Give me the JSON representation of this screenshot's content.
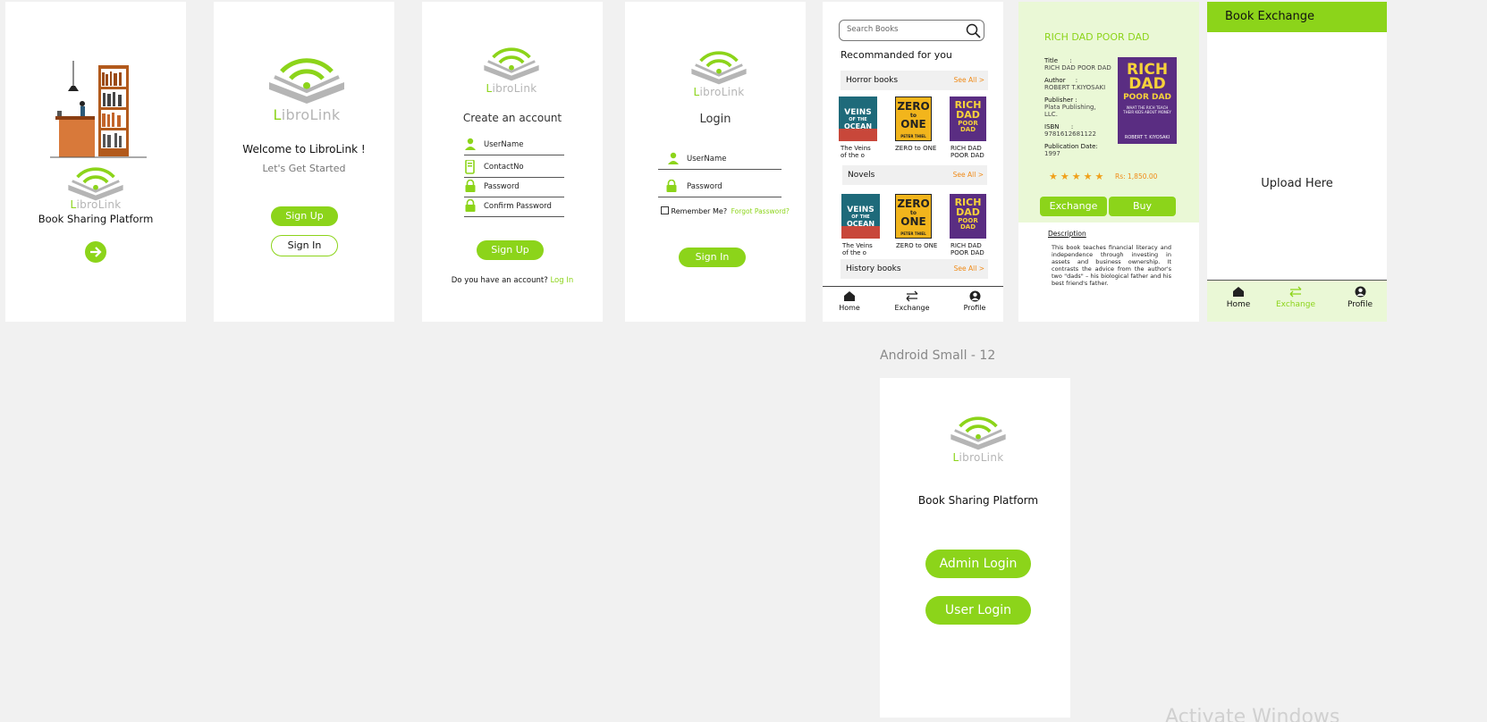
{
  "brand": {
    "logo_first": "L",
    "logo_rest": "ibroLink"
  },
  "screen1": {
    "title": "Book Sharing Platform",
    "next_icon": "arrow-right-icon"
  },
  "screen2": {
    "welcome": "Welcome to LibroLink !",
    "subtitle": "Let's Get Started",
    "signup_label": "Sign Up",
    "signin_label": "Sign In"
  },
  "screen3": {
    "title": "Create an account",
    "fields": [
      {
        "placeholder": "UserName",
        "icon": "user-icon"
      },
      {
        "placeholder": "ContactNo",
        "icon": "phone-icon"
      },
      {
        "placeholder": "Password",
        "icon": "lock-icon"
      },
      {
        "placeholder": "Confirm Password",
        "icon": "lock-icon"
      }
    ],
    "signup_label": "Sign Up",
    "login_prompt": "Do you have an account?",
    "login_link": "Log In"
  },
  "screen4": {
    "title": "Login",
    "fields": [
      {
        "placeholder": "UserName",
        "icon": "user-icon"
      },
      {
        "placeholder": "Password",
        "icon": "lock-icon"
      }
    ],
    "remember_label": "Remember Me?",
    "forgot_label": "Forgot Password?",
    "signin_label": "Sign In"
  },
  "screen5": {
    "search_placeholder": "Search Books",
    "heading": "Recommanded for you",
    "categories": [
      {
        "name": "Horror books",
        "see_all": "See All >",
        "books": [
          {
            "label": "The Veins of the o",
            "cover": "VEINS OF THE OCEAN",
            "cover_color": "#1e6a7a"
          },
          {
            "label": "ZERO to ONE",
            "cover": "ZERO to ONE",
            "cover_color": "#f2b51c"
          },
          {
            "label": "RICH DAD POOR DAD",
            "cover": "RICH DAD POOR DAD",
            "cover_color": "#5a2d82"
          }
        ]
      },
      {
        "name": "Novels",
        "see_all": "See All >",
        "books": [
          {
            "label": "The Veins of the o",
            "cover": "VEINS OF THE OCEAN",
            "cover_color": "#1e6a7a"
          },
          {
            "label": "ZERO to ONE",
            "cover": "ZERO to ONE",
            "cover_color": "#f2b51c"
          },
          {
            "label": "RICH DAD POOR DAD",
            "cover": "RICH DAD POOR DAD",
            "cover_color": "#5a2d82"
          }
        ]
      },
      {
        "name": "History books",
        "see_all": "See All >",
        "books": []
      }
    ],
    "nav": [
      {
        "label": "Home",
        "icon": "home-icon"
      },
      {
        "label": "Exchange",
        "icon": "exchange-icon"
      },
      {
        "label": "Profile",
        "icon": "profile-icon"
      }
    ]
  },
  "screen6": {
    "title": "RICH DAD POOR DAD",
    "rows": [
      {
        "key": "Title",
        "sep": ":",
        "value": "RICH DAD POOR DAD"
      },
      {
        "key": "Author",
        "sep": ":",
        "value": "ROBERT T.KIYOSAKI"
      },
      {
        "key": "Publisher :",
        "sep": "",
        "value": "Plata Publishing, LLC."
      },
      {
        "key": "ISBN",
        "sep": ":",
        "value": "9781612681122"
      },
      {
        "key": "Publication Date:",
        "sep": "",
        "value": "1997"
      }
    ],
    "stars": "★★★★★",
    "price": "Rs: 1,850.00",
    "exchange_label": "Exchange",
    "buy_label": "Buy",
    "desc_title": "Description",
    "description": "This book teaches financial literacy and independence through investing in assets and business ownership. It contrasts the advice from the author's two \"dads\" – his biological father and his best friend's father.",
    "cover_text": "RICH DAD POOR DAD",
    "cover_author": "ROBERT T. KIYOSAKI"
  },
  "screen7": {
    "header": "Book Exchange",
    "upload": "Upload Here",
    "nav": [
      {
        "label": "Home",
        "icon": "home-icon"
      },
      {
        "label": "Exchange",
        "icon": "exchange-icon"
      },
      {
        "label": "Profile",
        "icon": "profile-icon"
      }
    ]
  },
  "screen8": {
    "frame_label": "Android Small - 12",
    "title": "Book Sharing Platform",
    "admin_label": "Admin Login",
    "user_label": "User Login"
  },
  "watermark": "Activate Windows",
  "colors": {
    "accent": "#8cd41a",
    "link": "#f08a16",
    "light_green": "#eaf8d6"
  }
}
